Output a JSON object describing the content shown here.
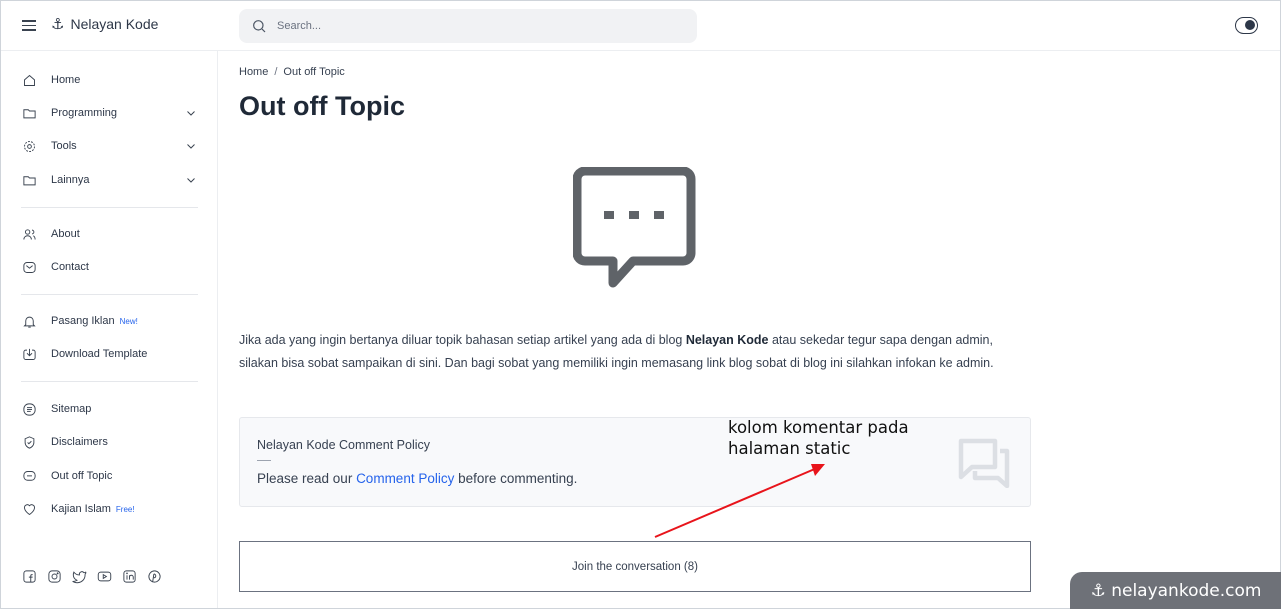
{
  "header": {
    "brand": "Nelayan Kode",
    "search_placeholder": "Search..."
  },
  "sidebar": {
    "items": [
      {
        "label": "Home",
        "icon": "home-icon",
        "chevron": false
      },
      {
        "label": "Programming",
        "icon": "folder-icon",
        "chevron": true
      },
      {
        "label": "Tools",
        "icon": "gear-icon",
        "chevron": true
      },
      {
        "label": "Lainnya",
        "icon": "folder-icon",
        "chevron": true
      },
      {
        "label": "About",
        "icon": "users-icon",
        "chevron": false
      },
      {
        "label": "Contact",
        "icon": "mail-icon",
        "chevron": false
      },
      {
        "label": "Pasang Iklan",
        "icon": "bell-icon",
        "badge": "New!"
      },
      {
        "label": "Download Template",
        "icon": "download-icon"
      },
      {
        "label": "Sitemap",
        "icon": "list-icon"
      },
      {
        "label": "Disclaimers",
        "icon": "shield-icon"
      },
      {
        "label": "Out off Topic",
        "icon": "chat-icon"
      },
      {
        "label": "Kajian Islam",
        "icon": "heart-icon",
        "badge": "Free!"
      }
    ],
    "social_icons": [
      "facebook-icon",
      "instagram-icon",
      "twitter-icon",
      "youtube-icon",
      "linkedin-icon",
      "pinterest-icon"
    ]
  },
  "main": {
    "breadcrumb": {
      "home": "Home",
      "sep": "/",
      "current": "Out off Topic"
    },
    "title": "Out off Topic",
    "desc": {
      "part1": "Jika ada yang ingin bertanya diluar topik bahasan setiap artikel yang ada di blog ",
      "bold": "Nelayan Kode",
      "part2": " atau sekedar tegur sapa dengan admin, silakan bisa sobat sampaikan di sini. Dan bagi sobat yang memiliki ingin memasang link blog sobat di blog ini silahkan infokan ke admin."
    },
    "policy": {
      "title": "Nelayan Kode Comment Policy",
      "text_before": "Please read our ",
      "link": "Comment Policy",
      "text_after": " before commenting."
    },
    "join_button": "Join the conversation (8)"
  },
  "annotation": {
    "line1": "kolom komentar pada",
    "line2": "halaman static",
    "color": "#e8141b"
  },
  "watermark": "⚓ nelayankode.com"
}
